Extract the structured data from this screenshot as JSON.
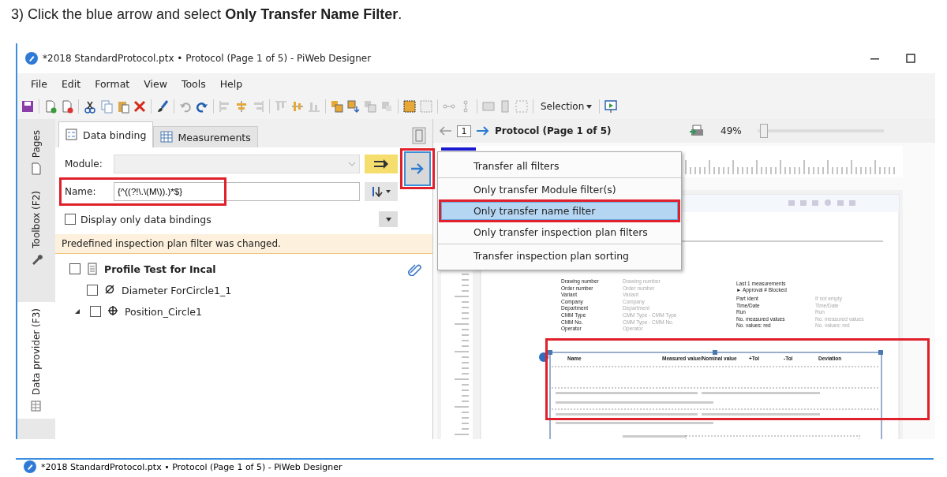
{
  "instruction": "3) Click the blue arrow and select **Only Transfer Name Filter**.",
  "window": {
    "title": "*2018 StandardProtocol.ptx • Protocol (Page 1 of 5) - PiWeb Designer"
  },
  "menu": [
    "File",
    "Edit",
    "Format",
    "View",
    "Tools",
    "Help"
  ],
  "toolbar": {
    "selection": "Selection"
  },
  "side_tabs": [
    {
      "label": "Pages",
      "selected": false
    },
    {
      "label": "Toolbox (F2)",
      "selected": false
    },
    {
      "label": "Data provider (F3)",
      "selected": true
    }
  ],
  "panel_tabs": [
    {
      "label": "Data binding",
      "selected": true
    },
    {
      "label": "Measurements",
      "selected": false
    }
  ],
  "module": {
    "label": "Module:",
    "disabled": true
  },
  "name_filter": {
    "label": "Name:",
    "value": "{^((?!\\.\\(M\\)).)*$}"
  },
  "display_only": {
    "label": "Display only data bindings",
    "checked": false
  },
  "notice": "Predefined inspection plan filter was changed.",
  "tree": [
    {
      "label": "Profile Test for Incal",
      "kind": "plan",
      "checked": false,
      "children": [
        {
          "label": "Diameter ForCircle1_1",
          "kind": "diameter",
          "checked": false
        },
        {
          "label": "Position_Circle1",
          "kind": "position",
          "checked": false,
          "expanded": true
        }
      ]
    }
  ],
  "nav": {
    "page": "1",
    "title": "Protocol (Page 1 of 5)",
    "zoom": "49%",
    "zoom_slider": {
      "level": 0.02
    }
  },
  "transfer_menu": [
    {
      "items": [
        {
          "label": "Transfer all filters",
          "selected": false
        }
      ]
    },
    {
      "items": [
        {
          "label": "Only transfer Module filter(s)",
          "selected": false
        },
        {
          "label": "Only transfer name filter",
          "selected": true
        },
        {
          "label": "Only transfer inspection plan filters",
          "selected": false
        }
      ]
    },
    {
      "items": [
        {
          "label": "Transfer inspection plan sorting",
          "selected": false
        }
      ]
    }
  ],
  "report": {
    "left_fields": [
      {
        "label": "Drawing number",
        "value": "Drawing number"
      },
      {
        "label": "Order number",
        "value": "Order number"
      },
      {
        "label": "Variant",
        "value": "Variant"
      },
      {
        "label": "Company",
        "value": "Company"
      },
      {
        "label": "Department",
        "value": "Department"
      },
      {
        "label": "CMM Type",
        "value": "CMM Type - CMM Type"
      },
      {
        "label": "CMM No.",
        "value": "CMM Type - CMM No."
      },
      {
        "label": "Operator",
        "value": "Operator"
      }
    ],
    "right_heading": [
      "Last 1 measurements",
      "► Approval # Blocked"
    ],
    "right_fields": [
      {
        "label": "Part ident",
        "value": "If not empty"
      },
      {
        "label": "Time/Date",
        "value": "Time/Date"
      },
      {
        "label": "Run",
        "value": "Run"
      },
      {
        "label": "No. measured values",
        "value": "No. measured values"
      },
      {
        "label": "No. values: red",
        "value": "No. values: red"
      }
    ],
    "table_columns": [
      "Name",
      "Measured value/Nominal value",
      "+Tol",
      "-Tol",
      "Deviation"
    ]
  },
  "second_window": {
    "title": "*2018 StandardProtocol.ptx • Protocol (Page 1 of 5) - PiWeb Designer"
  }
}
